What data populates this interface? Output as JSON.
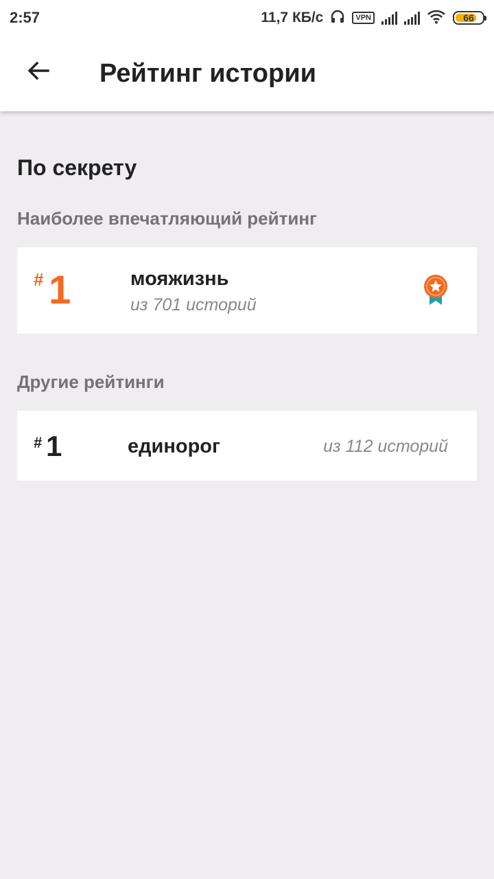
{
  "status_bar": {
    "time": "2:57",
    "speed": "11,7 КБ/с",
    "vpn": "VPN",
    "battery": "66",
    "icons": [
      "headphones-icon",
      "signal-icon",
      "wifi-icon",
      "battery-icon"
    ]
  },
  "app_bar": {
    "title": "Рейтинг истории",
    "back_icon": "arrow-left-icon"
  },
  "story": {
    "title": "По секрету"
  },
  "top_rating": {
    "heading": "Наиболее впечатляющий рейтинг",
    "hash": "#",
    "rank": "1",
    "tag": "мояжизнь",
    "count": "из 701 историй",
    "icon": "medal-icon",
    "accent_color": "#f26a1f"
  },
  "other_ratings": {
    "heading": "Другие рейтинги",
    "items": [
      {
        "hash": "#",
        "rank": "1",
        "tag": "единорог",
        "count": "из 112 историй"
      }
    ]
  }
}
